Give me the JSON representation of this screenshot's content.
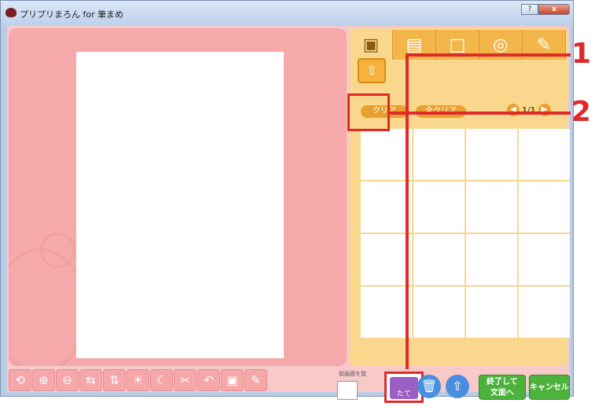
{
  "window": {
    "title": "プリプリまろん for 筆まめ",
    "help_btn": "?",
    "close_btn": "x"
  },
  "panel": {
    "tabs": [
      {
        "icon": "photo-icon"
      },
      {
        "icon": "frame-icon"
      },
      {
        "icon": "square-frame-icon"
      },
      {
        "icon": "zoom-icon"
      },
      {
        "icon": "pencil-icon"
      }
    ],
    "clear_label": "クリア",
    "clear_all_label": "全クリア",
    "page_indicator": "1/1"
  },
  "toolbar": {
    "small_label": "前画面を覚",
    "tate_label": "たて",
    "finish_label": "終了して\n文面へ",
    "cancel_label": "キャンセル"
  },
  "annotations": {
    "callout_1": "1",
    "callout_2": "2"
  },
  "colors": {
    "accent_red": "#e02a2a",
    "panel_yellow": "#f9d88e",
    "canvas_pink": "#f6a9aa"
  }
}
